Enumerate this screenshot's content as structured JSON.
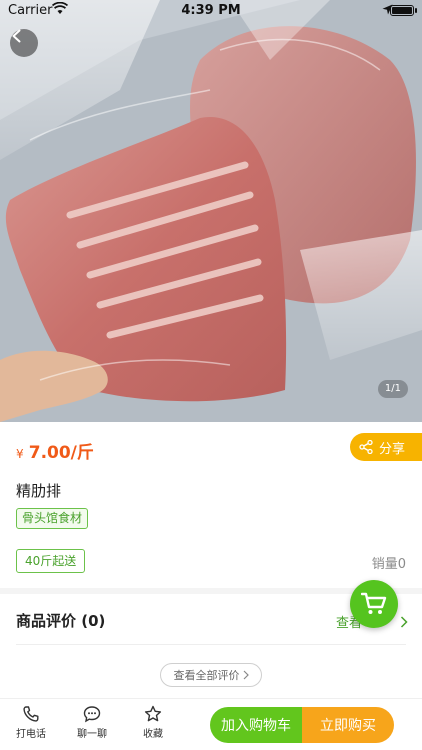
{
  "status_bar": {
    "carrier": "Carrier",
    "time": "4:39 PM",
    "icons": [
      "wifi-icon",
      "location-arrow-icon",
      "battery-icon"
    ]
  },
  "gallery": {
    "page_indicator": "1/1"
  },
  "product": {
    "currency": "¥",
    "price": "7.00/斤",
    "share_label": "分享",
    "name": "精肋排",
    "shop_tag": "骨头馆食材",
    "min_order": "40斤起送",
    "sales": "销量0"
  },
  "reviews": {
    "title": "商品评价 (0)",
    "more_label": "查看",
    "all_label": "查看全部评价"
  },
  "bottom_bar": {
    "call_label": "打电话",
    "chat_label": "聊一聊",
    "favorite_label": "收藏",
    "add_to_cart_label": "加入购物车",
    "buy_now_label": "立即购买"
  },
  "colors": {
    "price": "#f05a18",
    "accent_green": "#62c61d",
    "accent_orange": "#f7a51b",
    "share_bg": "#f7b300"
  }
}
